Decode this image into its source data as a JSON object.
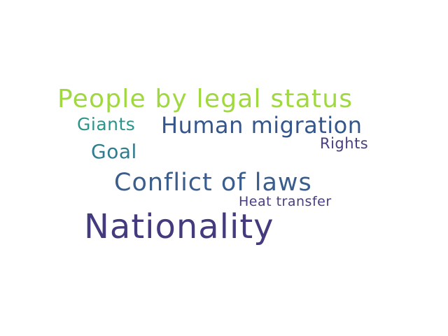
{
  "word_cloud": {
    "words": [
      {
        "text": "People by legal status",
        "color": "#a0d93f"
      },
      {
        "text": "Giants",
        "color": "#2a958a"
      },
      {
        "text": "Human migration",
        "color": "#34568c"
      },
      {
        "text": "Rights",
        "color": "#4a3d7e"
      },
      {
        "text": "Goal",
        "color": "#2e7d8e"
      },
      {
        "text": "Conflict of laws",
        "color": "#3a5d8c"
      },
      {
        "text": "Heat transfer",
        "color": "#4a3d7e"
      },
      {
        "text": "Nationality",
        "color": "#433b7d"
      }
    ]
  }
}
